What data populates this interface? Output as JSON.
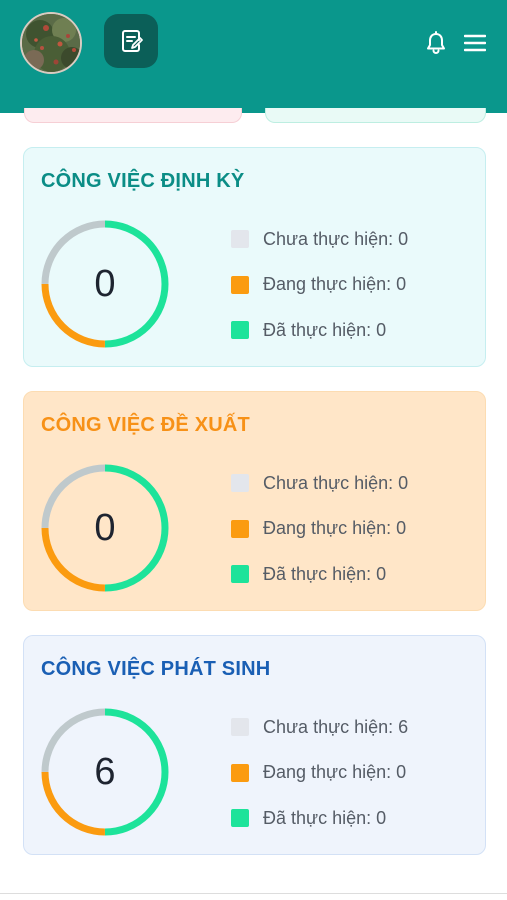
{
  "header": {
    "avatar_alt": "avatar",
    "note_icon": "note-edit-icon",
    "bell_icon": "bell-icon",
    "menu_icon": "hamburger-menu-icon"
  },
  "colors": {
    "header_bg": "#0a978c",
    "pending": "#bfc9cc",
    "in_progress": "#fb9b10",
    "done": "#1de39a",
    "legend_pending_swatch": "#e3e6ec"
  },
  "cards": {
    "periodic": {
      "title": "CÔNG VIỆC ĐỊNH KỲ",
      "title_color": "#0b8d86",
      "total": "0",
      "ring_fractions": {
        "pending": 0.25,
        "in_progress": 0.25,
        "done": 0.5
      },
      "legend": [
        {
          "label": "Chưa thực hiện: 0",
          "value": 0
        },
        {
          "label": "Đang thực hiện: 0",
          "value": 0
        },
        {
          "label": "Đã thực hiện: 0",
          "value": 0
        }
      ]
    },
    "proposed": {
      "title": "CÔNG VIỆC ĐỀ XUẤT",
      "title_color": "#f79117",
      "total": "0",
      "ring_fractions": {
        "pending": 0.25,
        "in_progress": 0.25,
        "done": 0.5
      },
      "legend": [
        {
          "label": "Chưa thực hiện: 0",
          "value": 0
        },
        {
          "label": "Đang thực hiện: 0",
          "value": 0
        },
        {
          "label": "Đã thực hiện: 0",
          "value": 0
        }
      ]
    },
    "arising": {
      "title": "CÔNG VIỆC PHÁT SINH",
      "title_color": "#1a5fb4",
      "total": "6",
      "ring_fractions": {
        "pending": 0.25,
        "in_progress": 0.25,
        "done": 0.5
      },
      "legend": [
        {
          "label": "Chưa thực hiện: 6",
          "value": 6
        },
        {
          "label": "Đang thực hiện: 0",
          "value": 0
        },
        {
          "label": "Đã thực hiện: 0",
          "value": 0
        }
      ]
    }
  }
}
